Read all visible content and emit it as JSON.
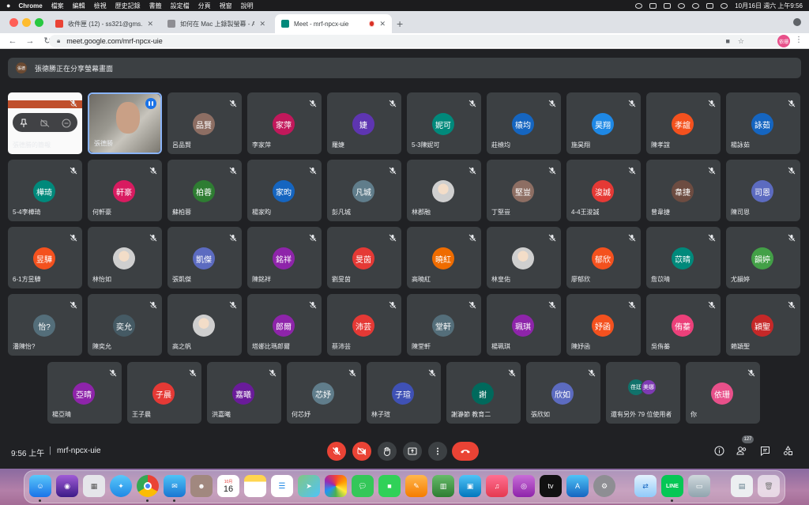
{
  "menubar": {
    "app": "Chrome",
    "items": [
      "檔案",
      "編輯",
      "檢視",
      "歷史記錄",
      "書籤",
      "設定檔",
      "分頁",
      "視窗",
      "說明"
    ],
    "datetime": "10月16日 週六 上午9:56"
  },
  "tabs": [
    {
      "title": "收件匣 (12) - ss321@gms.ndhu",
      "favicon": "gmail-icon",
      "color": "#ea4335"
    },
    {
      "title": "如何在 Mac 上錄製螢幕 - Apple",
      "favicon": "apple-icon",
      "color": "#8e8e93"
    },
    {
      "title": "Meet - mrf-npcx-uie",
      "favicon": "meet-icon",
      "color": "#00897b",
      "active": true
    }
  ],
  "address": {
    "url": "meet.google.com/mrf-npcx-uie",
    "profile_initials": "依珊"
  },
  "share_banner": {
    "badge": "張德",
    "text": "張德勝正在分享螢幕畫面"
  },
  "presenter_tile": {
    "name": "張德勝的簡報"
  },
  "self_tile": {
    "name": "張德勝"
  },
  "participants": [
    {
      "initials": "品賢",
      "name": "呂品賢",
      "color": "#8d6e63"
    },
    {
      "initials": "家萍",
      "name": "李家萍",
      "color": "#c2185b"
    },
    {
      "initials": "婕",
      "name": "羅婕",
      "color": "#5e35b1"
    },
    {
      "initials": "妮可",
      "name": "5-3陳妮可",
      "color": "#00897b"
    },
    {
      "initials": "榬均",
      "name": "莊榬均",
      "color": "#1565c0"
    },
    {
      "initials": "昊翔",
      "name": "施昊翔",
      "color": "#1e88e5"
    },
    {
      "initials": "孝誼",
      "name": "陳孝誼",
      "color": "#f4511e"
    },
    {
      "initials": "詠茹",
      "name": "楊詠茹",
      "color": "#1565c0"
    },
    {
      "initials": "樺琦",
      "name": "5-4李樺琦",
      "color": "#00897b"
    },
    {
      "initials": "軒豪",
      "name": "何軒豪",
      "color": "#d81b60"
    },
    {
      "initials": "柏蓉",
      "name": "蘇柏蓉",
      "color": "#2e7d32"
    },
    {
      "initials": "家昀",
      "name": "楊家昀",
      "color": "#1565c0"
    },
    {
      "initials": "凡城",
      "name": "彭凡城",
      "color": "#607d8b"
    },
    {
      "initials": "",
      "name": "林郡融",
      "color": "#e0e0e0",
      "photo": true
    },
    {
      "initials": "堅豈",
      "name": "丁堅豈",
      "color": "#8d6e63"
    },
    {
      "initials": "浚誠",
      "name": "4-4王浚誠",
      "color": "#e53935"
    },
    {
      "initials": "韋捷",
      "name": "曾韋捷",
      "color": "#6d4c41"
    },
    {
      "initials": "司恩",
      "name": "陳司恩",
      "color": "#5c6bc0"
    },
    {
      "initials": "昱驊",
      "name": "6-1方昱驊",
      "color": "#f4511e"
    },
    {
      "initials": "",
      "name": "林怡如",
      "color": "#e0e0e0",
      "photo": true
    },
    {
      "initials": "凱傑",
      "name": "張凱傑",
      "color": "#5c6bc0"
    },
    {
      "initials": "銘祥",
      "name": "陳銘祥",
      "color": "#8e24aa"
    },
    {
      "initials": "旻茵",
      "name": "劉旻茵",
      "color": "#e53935"
    },
    {
      "initials": "曉紅",
      "name": "高曉紅",
      "color": "#ef6c00"
    },
    {
      "initials": "",
      "name": "林皇佑",
      "color": "#e0e0e0",
      "photo": true
    },
    {
      "initials": "郁欣",
      "name": "廖郁欣",
      "color": "#f4511e"
    },
    {
      "initials": "苡晴",
      "name": "詹苡晴",
      "color": "#00897b"
    },
    {
      "initials": "韻婷",
      "name": "尤韻婷",
      "color": "#43a047"
    },
    {
      "initials": "怡?",
      "name": "潘陳怡?",
      "color": "#546e7a"
    },
    {
      "initials": "奕允",
      "name": "陳奕允",
      "color": "#455a64"
    },
    {
      "initials": "",
      "name": "高之帆",
      "color": "#e0e0e0",
      "photo": true
    },
    {
      "initials": "郎爾",
      "name": "塔娜比瑪郎爾",
      "color": "#8e24aa"
    },
    {
      "initials": "沛芸",
      "name": "蔡沛芸",
      "color": "#e53935"
    },
    {
      "initials": "堂軒",
      "name": "陳堂軒",
      "color": "#546e7a"
    },
    {
      "initials": "珮琪",
      "name": "楊珮琪",
      "color": "#8e24aa"
    },
    {
      "initials": "妤函",
      "name": "陳妤函",
      "color": "#f4511e"
    },
    {
      "initials": "侑蓁",
      "name": "吳侑蓁",
      "color": "#ec407a"
    },
    {
      "initials": "穎聖",
      "name": "賴穎聖",
      "color": "#c62828"
    },
    {
      "initials": "亞晴",
      "name": "楊亞晴",
      "color": "#8e24aa"
    },
    {
      "initials": "子晨",
      "name": "王子晨",
      "color": "#e53935"
    },
    {
      "initials": "嘉曦",
      "name": "洪嘉曦",
      "color": "#6a1b9a"
    },
    {
      "initials": "芯妤",
      "name": "何芯妤",
      "color": "#607d8b"
    },
    {
      "initials": "子瑄",
      "name": "林子瑄",
      "color": "#3f51b5"
    },
    {
      "initials": "謝",
      "name": "謝瀞節 教育二",
      "color": "#00695c"
    },
    {
      "initials": "欣如",
      "name": "張欣如",
      "color": "#5c6bc0"
    }
  ],
  "more_tile": {
    "a1": "荏廷",
    "a2": "美娜",
    "text": "還有另外 79 位使用者"
  },
  "you_tile": {
    "initials": "依珊",
    "name": "你",
    "color": "#e8508a"
  },
  "bottom": {
    "time": "9:56 上午",
    "separator": "|",
    "code": "mrf-npcx-uie",
    "people_count": "127"
  },
  "dock": {
    "calendar_month": "10月",
    "calendar_day": "16"
  }
}
